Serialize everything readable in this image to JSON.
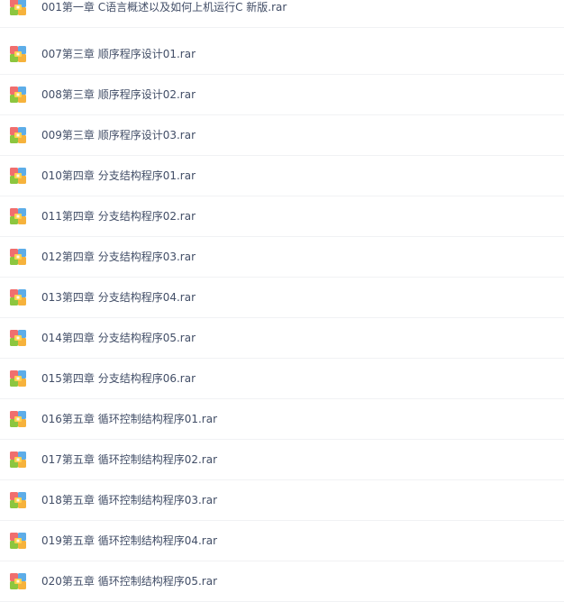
{
  "file_list": {
    "files": [
      {
        "name": "001第一章 C语言概述以及如何上机运行C 新版.rar",
        "icon": "rar-archive-icon"
      },
      {
        "name": "007第三章 顺序程序设计01.rar",
        "icon": "rar-archive-icon"
      },
      {
        "name": "008第三章 顺序程序设计02.rar",
        "icon": "rar-archive-icon"
      },
      {
        "name": "009第三章 顺序程序设计03.rar",
        "icon": "rar-archive-icon"
      },
      {
        "name": "010第四章 分支结构程序01.rar",
        "icon": "rar-archive-icon"
      },
      {
        "name": "011第四章 分支结构程序02.rar",
        "icon": "rar-archive-icon"
      },
      {
        "name": "012第四章 分支结构程序03.rar",
        "icon": "rar-archive-icon"
      },
      {
        "name": "013第四章 分支结构程序04.rar",
        "icon": "rar-archive-icon"
      },
      {
        "name": "014第四章 分支结构程序05.rar",
        "icon": "rar-archive-icon"
      },
      {
        "name": "015第四章 分支结构程序06.rar",
        "icon": "rar-archive-icon"
      },
      {
        "name": "016第五章 循环控制结构程序01.rar",
        "icon": "rar-archive-icon"
      },
      {
        "name": "017第五章 循环控制结构程序02.rar",
        "icon": "rar-archive-icon"
      },
      {
        "name": "018第五章 循环控制结构程序03.rar",
        "icon": "rar-archive-icon"
      },
      {
        "name": "019第五章 循环控制结构程序04.rar",
        "icon": "rar-archive-icon"
      },
      {
        "name": "020第五章 循环控制结构程序05.rar",
        "icon": "rar-archive-icon"
      }
    ]
  },
  "colors": {
    "text": "#424e67",
    "divider": "#f1f2f4",
    "icon_top_left": "#f06e6e",
    "icon_top_right": "#5dade8",
    "icon_bottom_left": "#8cc63f",
    "icon_bottom_right": "#f6b23c",
    "icon_clasp": "#ffd24d"
  }
}
